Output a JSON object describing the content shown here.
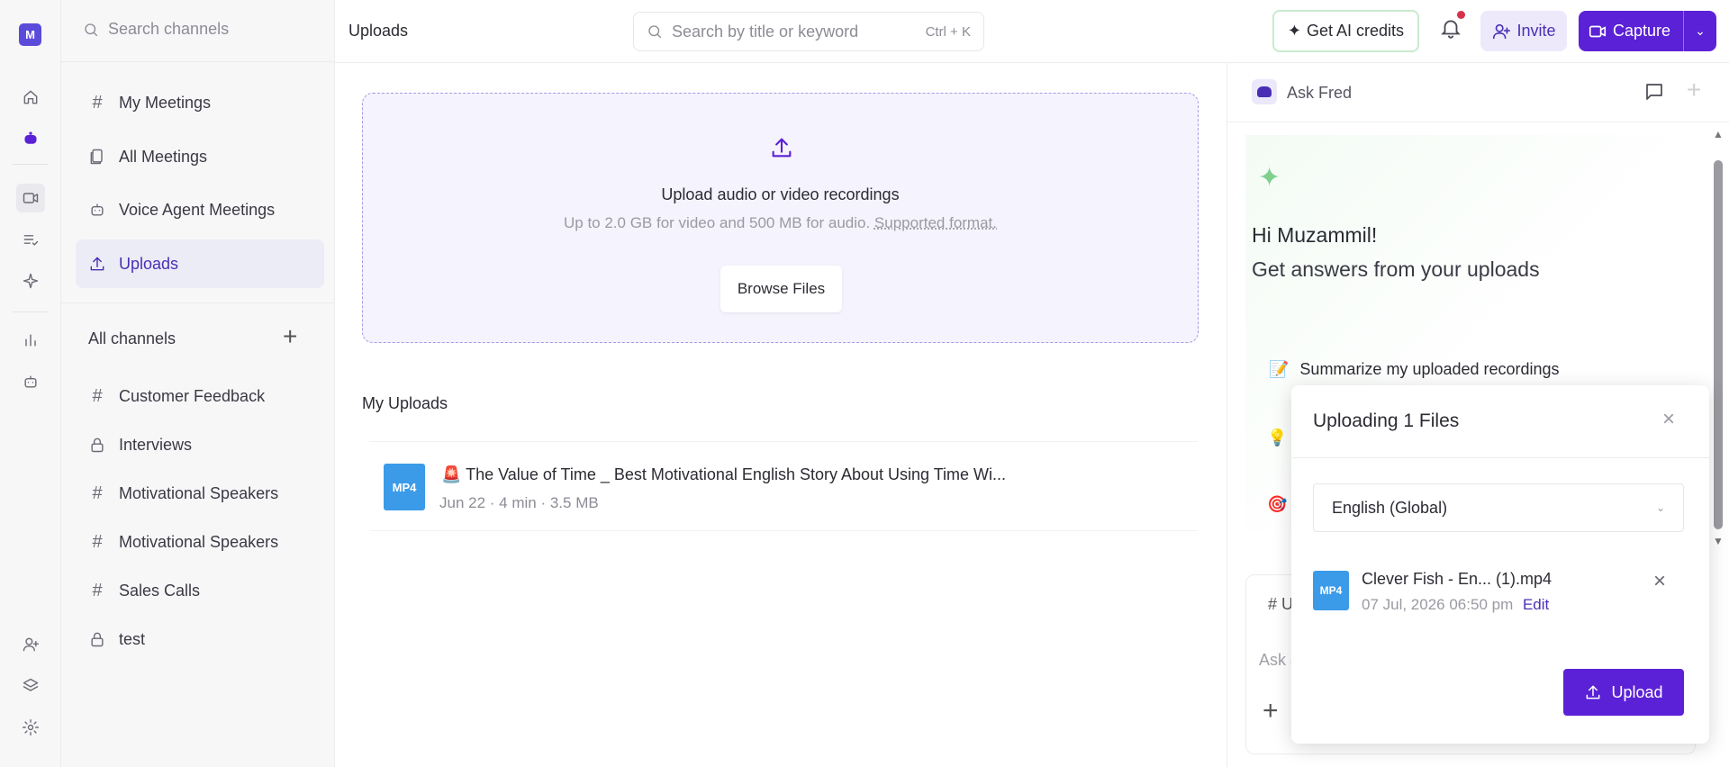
{
  "workspace": {
    "avatar_letter": "M"
  },
  "sidebar": {
    "search_placeholder": "Search channels",
    "nav": [
      {
        "label": "My Meetings",
        "icon": "hash-icon"
      },
      {
        "label": "All Meetings",
        "icon": "documents-icon"
      },
      {
        "label": "Voice Agent Meetings",
        "icon": "robot-icon"
      },
      {
        "label": "Uploads",
        "icon": "upload-icon",
        "active": true
      }
    ],
    "all_channels_label": "All channels",
    "channels": [
      {
        "label": "Customer Feedback",
        "icon": "hash-icon"
      },
      {
        "label": "Interviews",
        "icon": "lock-icon"
      },
      {
        "label": "Motivational Speakers",
        "icon": "hash-icon"
      },
      {
        "label": "Motivational Speakers",
        "icon": "hash-icon"
      },
      {
        "label": "Sales Calls",
        "icon": "hash-icon"
      },
      {
        "label": "test",
        "icon": "lock-icon"
      }
    ]
  },
  "header": {
    "title": "Uploads",
    "search_placeholder": "Search by title or keyword",
    "search_shortcut": "Ctrl + K",
    "ai_credits_label": "Get AI credits",
    "invite_label": "Invite",
    "capture_label": "Capture"
  },
  "dropzone": {
    "title": "Upload audio or video recordings",
    "subtitle": "Up to 2.0 GB for video and 500 MB for audio.",
    "supported_link": "Supported format.",
    "browse_label": "Browse Files"
  },
  "my_uploads": {
    "heading": "My Uploads",
    "items": [
      {
        "badge": "MP4",
        "emoji": "🚨",
        "title": "The Value of Time _ Best Motivational English Story About Using Time Wi...",
        "date": "Jun 22",
        "duration": "4 min",
        "size": "3.5 MB"
      }
    ]
  },
  "ask_fred": {
    "title": "Ask Fred",
    "greeting": "Hi Muzammil!",
    "subtitle": "Get answers from your uploads",
    "suggestion": "Summarize my uploaded recordings",
    "composer_prefix": "# U",
    "composer_placeholder": "Ask a"
  },
  "upload_modal": {
    "title": "Uploading 1 Files",
    "language": "English (Global)",
    "file": {
      "badge": "MP4",
      "name": "Clever Fish - En... (1).mp4",
      "datetime": "07 Jul, 2026 06:50 pm",
      "edit_label": "Edit"
    },
    "upload_label": "Upload"
  },
  "colors": {
    "accent": "#5b21d6",
    "accent_soft": "#ede9fb",
    "notification_dot": "#d6324a",
    "file_badge": "#3b9be8"
  }
}
